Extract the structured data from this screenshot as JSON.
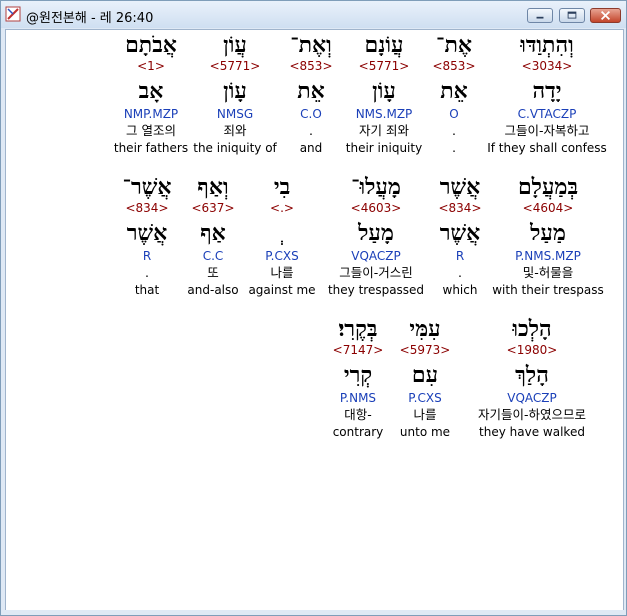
{
  "window": {
    "title": "@원전본해 - 레 26:40",
    "buttons": [
      "minimize",
      "maximize",
      "close"
    ]
  },
  "rows": [
    {
      "words": [
        {
          "heb": "וְהִתְוַדּוּ",
          "strong": "<3034>",
          "lemma": "יָדָה",
          "parse": "C.VTACZP",
          "kor": "그들이-자복하고",
          "eng": "If they shall confess",
          "selected": true
        },
        {
          "heb": "אֶת־",
          "strong": "<853>",
          "lemma": "אֵת",
          "parse": "O",
          "kor": ".",
          "eng": "."
        },
        {
          "heb": "עֲוֹנָם",
          "strong": "<5771>",
          "lemma": "עָוֹן",
          "parse": "NMS.MZP",
          "kor": "자기 죄와",
          "eng": "their iniquity"
        },
        {
          "heb": "וְאֶת־",
          "strong": "<853>",
          "lemma": "אֵת",
          "parse": "C.O",
          "kor": ".",
          "eng": "and"
        },
        {
          "heb": "עֲוֹן",
          "strong": "<5771>",
          "lemma": "עָוֹן",
          "parse": "NMSG",
          "kor": "죄와",
          "eng": "the iniquity of"
        },
        {
          "heb": "אֲבֹתָם",
          "strong": "<1>",
          "lemma": "אָב",
          "parse": "NMP.MZP",
          "kor": "그 열조의",
          "eng": "their fathers"
        }
      ]
    },
    {
      "words": [
        {
          "heb": "בְּמַעֲלָם",
          "strong": "<4604>",
          "lemma": "מַעַל",
          "parse": "P.NMS.MZP",
          "kor": "및-허물을",
          "eng": "with their trespass"
        },
        {
          "heb": "אֲשֶׁר",
          "strong": "<834>",
          "lemma": "אֲשֶׁר",
          "parse": "R",
          "kor": ".",
          "eng": "which"
        },
        {
          "heb": "מָעֲלוּ־",
          "strong": "<4603>",
          "lemma": "מָעַל",
          "parse": "VQACZP",
          "kor": "그들이-거스린",
          "eng": "they trespassed"
        },
        {
          "heb": "בִי",
          "strong": "<.>",
          "lemma": "ְ",
          "parse": "P.CXS",
          "kor": "나를",
          "eng": "against me"
        },
        {
          "heb": "וְאַף",
          "strong": "<637>",
          "lemma": "אַף",
          "parse": "C.C",
          "kor": "또",
          "eng": "and-also"
        },
        {
          "heb": "אֲשֶׁר־",
          "strong": "<834>",
          "lemma": "אֲשֶׁר",
          "parse": "R",
          "kor": ".",
          "eng": "that"
        }
      ]
    },
    {
      "words": [
        {
          "heb": "הָלְכוּ",
          "strong": "<1980>",
          "lemma": "הָלַךְ",
          "parse": "VQACZP",
          "kor": "자기들이-하였으므로",
          "eng": "they have walked"
        },
        {
          "heb": "עִמִּי",
          "strong": "<5973>",
          "lemma": "עִם",
          "parse": "P.CXS",
          "kor": "나를",
          "eng": "unto me"
        },
        {
          "heb": "בְּקֶרִי׃",
          "strong": "<7147>",
          "lemma": "קְרִי",
          "parse": "P.NMS",
          "kor": "대항-",
          "eng": "contrary"
        }
      ]
    }
  ]
}
